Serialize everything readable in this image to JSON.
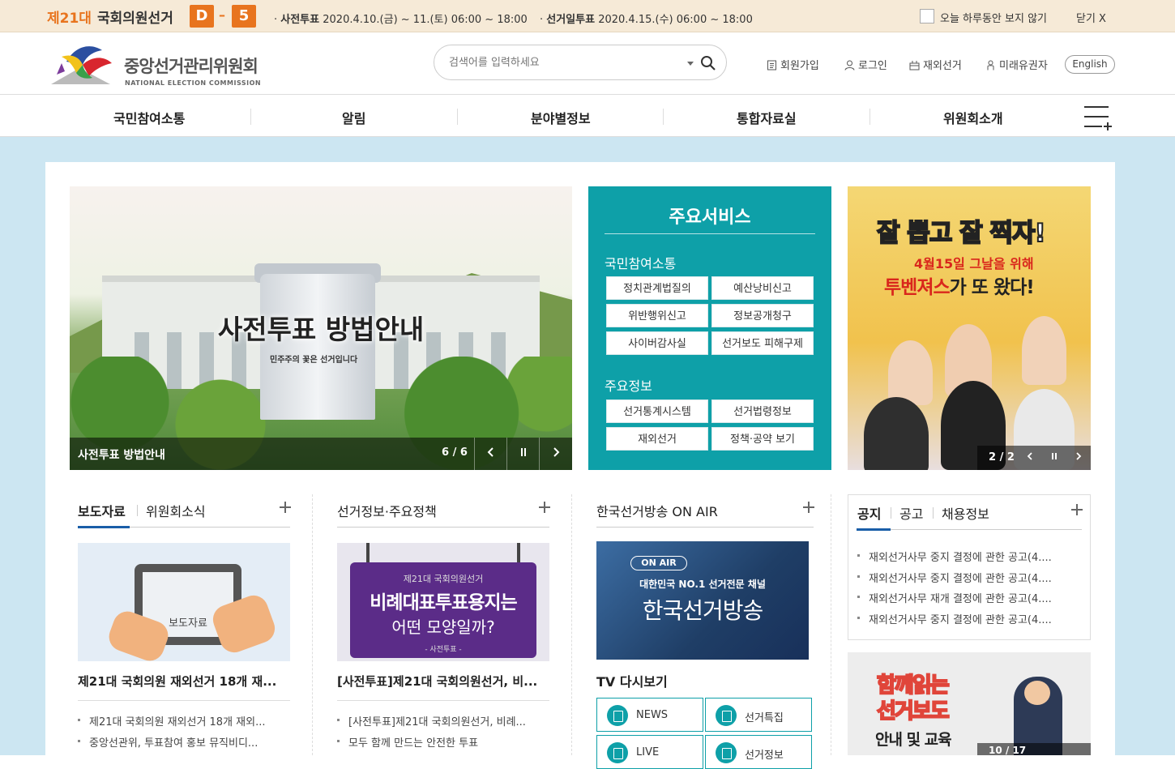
{
  "banner": {
    "election_num": "제21대",
    "election_name": "국회의원선거",
    "d_label": "D",
    "dash": "–",
    "d_days": "5",
    "early_label": "사전투표",
    "early_time": "2020.4.10.(금) ~ 11.(토) 06:00 ~ 18:00",
    "day_label": "선거일투표",
    "day_time": "2020.4.15.(수) 06:00 ~ 18:00",
    "hide_today": "오늘 하루동안 보지 않기",
    "close": "닫기 X"
  },
  "header": {
    "logo_kr": "중앙선거관리위원회",
    "logo_en": "NATIONAL ELECTION COMMISSION",
    "search_placeholder": "검색어를 입력하세요",
    "util": [
      "회원가입",
      "로그인",
      "재외선거",
      "미래유권자"
    ],
    "english": "English"
  },
  "nav": [
    "국민참여소통",
    "알림",
    "분야별정보",
    "통합자료실",
    "위원회소개"
  ],
  "hero": {
    "title": "사전투표 방법안내",
    "subtitle": "민주주의 꽃은 선거입니다",
    "caption": "사전투표 방법안내",
    "counter": "6 / 6"
  },
  "services": {
    "title": "주요서비스",
    "group1_title": "국민참여소통",
    "group1": [
      "정치관계법질의",
      "예산낭비신고",
      "위반행위신고",
      "정보공개청구",
      "사이버감사실",
      "선거보도 피해구제"
    ],
    "group2_title": "주요정보",
    "group2": [
      "선거통계시스템",
      "선거법령정보",
      "재외선거",
      "정책·공약 보기"
    ]
  },
  "ad": {
    "line1": "잘 뽑고 잘 찍자!",
    "line2": "4월15일 그날을 위해",
    "line3a": "투벤져스",
    "line3b": "가 또 왔다!",
    "counter": "2 / 2"
  },
  "col1": {
    "tabs": [
      "보도자료",
      "위원회소식"
    ],
    "thumb_label": "보도자료",
    "headline": "제21대 국회의원 재외선거 18개 재...",
    "items": [
      "제21대 국회의원 재외선거 18개 재외...",
      "중앙선관위, 투표참여 홍보 뮤직비디..."
    ]
  },
  "col2": {
    "title": "선거정보·주요정책",
    "board_l1": "제21대 국회의원선거",
    "board_l2": "비례대표투표용지는",
    "board_l3": "어떤 모양일까?",
    "board_l4": "- 사전투표 -",
    "headline": "[사전투표]제21대 국회의원선거, 비...",
    "items": [
      "[사전투표]제21대 국회의원선거, 비례...",
      "모두 함께 만드는 안전한 투표"
    ]
  },
  "col3": {
    "title": "한국선거방송 ON AIR",
    "onair": "ON AIR",
    "s1": "대한민국 NO.1 선거전문 채널",
    "s2": "한국선거방송",
    "tv_title": "TV 다시보기",
    "buttons": [
      "NEWS",
      "선거특집",
      "LIVE",
      "선거정보"
    ]
  },
  "notice": {
    "tabs": [
      "공지",
      "공고",
      "채용정보"
    ],
    "items": [
      "재외선거사무 중지 결정에 관한 공고(4....",
      "재외선거사무 중지 결정에 관한 공고(4....",
      "재외선거사무 재개 결정에 관한 공고(4....",
      "재외선거사무 중지 결정에 관한 공고(4...."
    ]
  },
  "ad2": {
    "l1": "함께읽는",
    "l2": "선거보도",
    "l3": "안내 및 교육",
    "counter": "10 / 17"
  },
  "colors": {
    "orange": "#e8741e",
    "teal": "#0ea0a8",
    "blue_bg": "#cce6f2",
    "active_blue": "#1a5ea8"
  }
}
